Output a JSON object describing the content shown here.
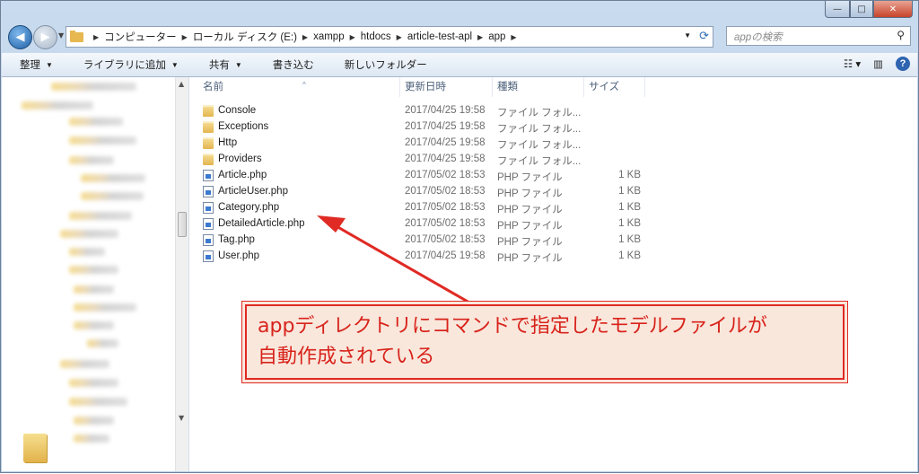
{
  "window": {
    "min": "—",
    "max": "□",
    "close": "✕"
  },
  "address": {
    "crumbs": [
      "コンピューター",
      "ローカル ディスク (E:)",
      "xampp",
      "htdocs",
      "article-test-apl",
      "app"
    ]
  },
  "search": {
    "placeholder": "appの検索"
  },
  "toolbar": {
    "organize": "整理",
    "library": "ライブラリに追加",
    "share": "共有",
    "burn": "書き込む",
    "new_folder": "新しいフォルダー"
  },
  "columns": {
    "name": "名前",
    "date": "更新日時",
    "type": "種類",
    "size": "サイズ"
  },
  "files": [
    {
      "name": "Console",
      "date": "2017/04/25 19:58",
      "type": "ファイル フォル...",
      "size": "",
      "kind": "folder"
    },
    {
      "name": "Exceptions",
      "date": "2017/04/25 19:58",
      "type": "ファイル フォル...",
      "size": "",
      "kind": "folder"
    },
    {
      "name": "Http",
      "date": "2017/04/25 19:58",
      "type": "ファイル フォル...",
      "size": "",
      "kind": "folder"
    },
    {
      "name": "Providers",
      "date": "2017/04/25 19:58",
      "type": "ファイル フォル...",
      "size": "",
      "kind": "folder"
    },
    {
      "name": "Article.php",
      "date": "2017/05/02 18:53",
      "type": "PHP ファイル",
      "size": "1 KB",
      "kind": "php"
    },
    {
      "name": "ArticleUser.php",
      "date": "2017/05/02 18:53",
      "type": "PHP ファイル",
      "size": "1 KB",
      "kind": "php"
    },
    {
      "name": "Category.php",
      "date": "2017/05/02 18:53",
      "type": "PHP ファイル",
      "size": "1 KB",
      "kind": "php"
    },
    {
      "name": "DetailedArticle.php",
      "date": "2017/05/02 18:53",
      "type": "PHP ファイル",
      "size": "1 KB",
      "kind": "php"
    },
    {
      "name": "Tag.php",
      "date": "2017/05/02 18:53",
      "type": "PHP ファイル",
      "size": "1 KB",
      "kind": "php"
    },
    {
      "name": "User.php",
      "date": "2017/04/25 19:58",
      "type": "PHP ファイル",
      "size": "1 KB",
      "kind": "php"
    }
  ],
  "annotation": {
    "line1": "appディレクトリにコマンドで指定したモデルファイルが",
    "line2": "自動作成されている",
    "color": "#e02a24"
  }
}
